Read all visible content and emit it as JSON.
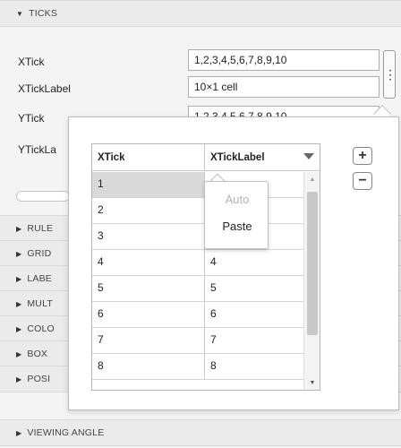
{
  "inspector": {
    "ticks_section": "TICKS",
    "rows": [
      {
        "label": "XTick",
        "value": "1,2,3,4,5,6,7,8,9,10"
      },
      {
        "label": "XTickLabel",
        "value": "10×1 cell"
      },
      {
        "label": "YTick",
        "value": "1,2,3,4,5,6,7,8,9,10"
      },
      {
        "label": "YTickLa",
        "value": ""
      }
    ],
    "kebab_glyph": "⋮",
    "collapsed_sections": [
      "RULE",
      "GRID",
      "LABE",
      "MULT",
      "COLO",
      "BOX",
      "POSI"
    ],
    "viewing_angle_section": "VIEWING ANGLE"
  },
  "editor": {
    "columns": [
      "XTick",
      "XTickLabel"
    ],
    "rows": [
      {
        "xtick": "1",
        "label": ""
      },
      {
        "xtick": "2",
        "label": ""
      },
      {
        "xtick": "3",
        "label": ""
      },
      {
        "xtick": "4",
        "label": "4"
      },
      {
        "xtick": "5",
        "label": "5"
      },
      {
        "xtick": "6",
        "label": "6"
      },
      {
        "xtick": "7",
        "label": "7"
      },
      {
        "xtick": "8",
        "label": "8"
      }
    ],
    "selected_row": 0,
    "add_label": "+",
    "remove_label": "−"
  },
  "context_menu": {
    "items": [
      {
        "label": "Auto",
        "enabled": false
      },
      {
        "label": "Paste",
        "enabled": true
      }
    ]
  }
}
